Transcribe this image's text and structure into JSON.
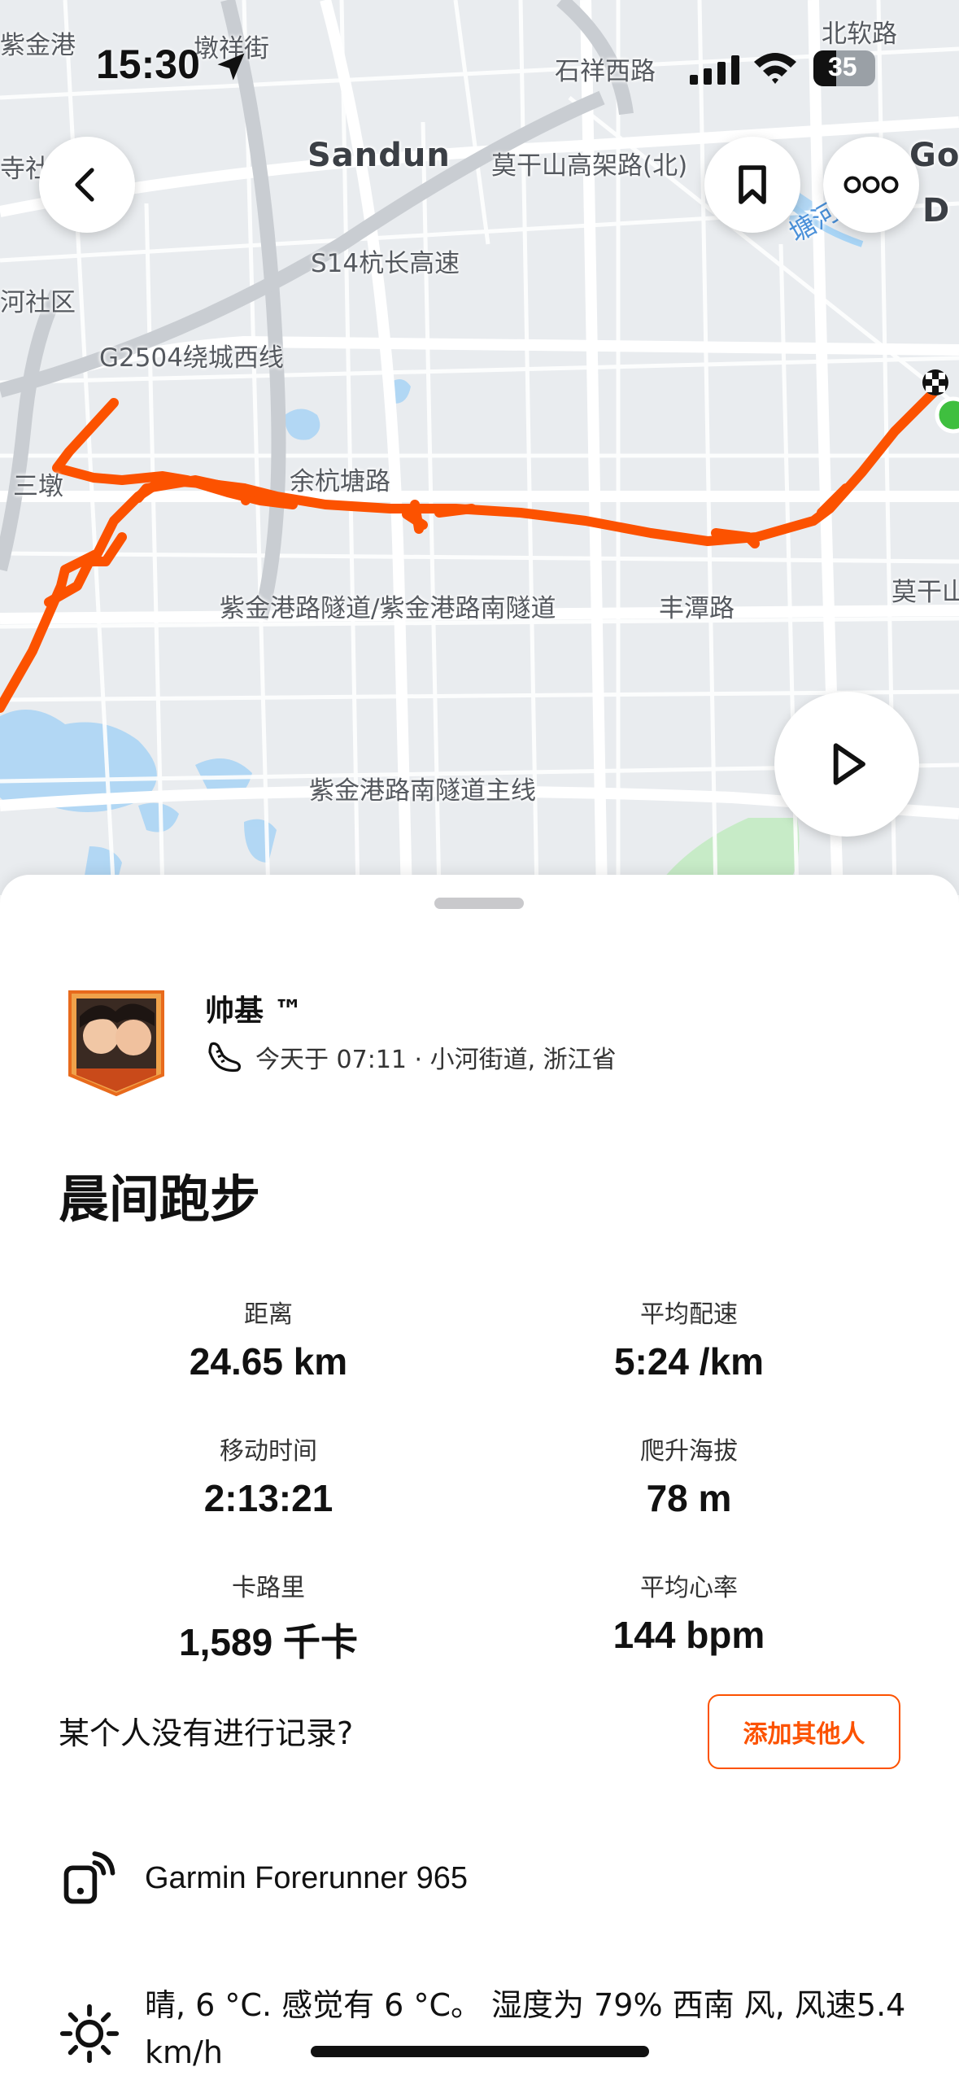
{
  "status_bar": {
    "time": "15:30",
    "battery": "35"
  },
  "map": {
    "labels": {
      "zijingang": "紫金港",
      "dunxiang": "墩祥街",
      "beiruan": "北软路",
      "shixiang": "石祥西路",
      "sandun_en": "Sandun",
      "moganshan_elev": "莫干山高架路(北)",
      "s14": "S14杭长高速",
      "hesheq": "河社区",
      "g2504": "G2504绕城西线",
      "sandun_cn": "三墩",
      "yuhangtang": "余杭塘路",
      "tunnel": "紫金港路隧道/紫金港路南隧道",
      "fengtan": "丰潭路",
      "moganshan_edge": "莫干山",
      "south_tunnel_main": "紫金港路南隧道主线",
      "tanghe": "塘河",
      "left_edge": "寺社区",
      "go": "Go",
      "d": "D"
    },
    "route_color": "#fc5200"
  },
  "activity": {
    "athlete_name": "帅基 ™",
    "meta": "今天于 07:11 · 小河街道, 浙江省",
    "title": "晨间跑步"
  },
  "stats": {
    "distance": {
      "label": "距离",
      "value": "24.65 km"
    },
    "pace": {
      "label": "平均配速",
      "value": "5:24 /km"
    },
    "moving_time": {
      "label": "移动时间",
      "value": "2:13:21"
    },
    "elevation": {
      "label": "爬升海拔",
      "value": "78 m"
    },
    "calories": {
      "label": "卡路里",
      "value": "1,589 千卡"
    },
    "heart_rate": {
      "label": "平均心率",
      "value": "144 bpm"
    }
  },
  "partners": {
    "prompt": "某个人没有进行记录?",
    "button": "添加其他人"
  },
  "device": {
    "name": "Garmin Forerunner 965"
  },
  "weather": {
    "text": "晴, 6 °C. 感觉有 6 °C。 湿度为 79% 西南 风, 风速5.4 km/h"
  },
  "colors": {
    "accent": "#fc5200",
    "map_bg": "#e9ecef",
    "water": "#a8d4f5",
    "green_start": "#3fbf3f"
  },
  "icons": [
    "location-arrow-icon",
    "signal-icon",
    "wifi-icon",
    "battery-icon",
    "back-chevron-icon",
    "bookmark-icon",
    "more-icon",
    "play-icon",
    "shoe-icon",
    "device-icon",
    "sun-icon"
  ]
}
